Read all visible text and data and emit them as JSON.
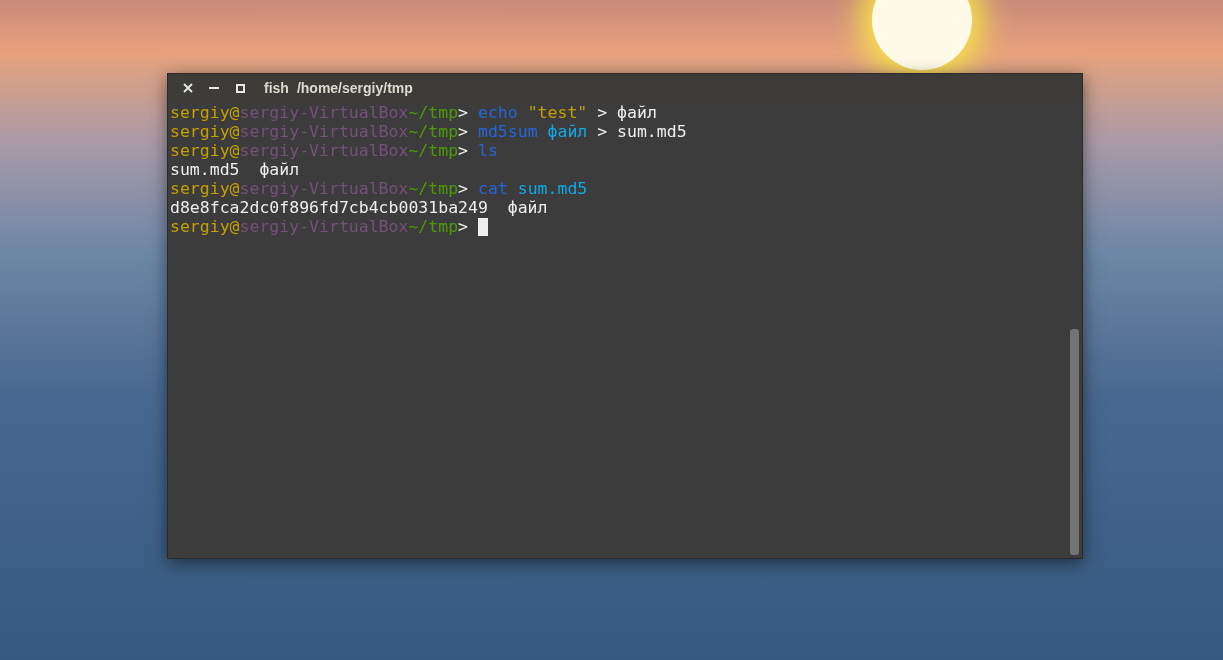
{
  "window": {
    "title_app": "fish",
    "title_path": "/home/sergiy/tmp"
  },
  "terminal": {
    "lines": [
      {
        "segments": [
          {
            "kind": "user",
            "text": "sergiy@"
          },
          {
            "kind": "host",
            "text": "sergiy-VirtualBox"
          },
          {
            "kind": "path",
            "text": "~/tmp"
          },
          {
            "kind": "plain",
            "text": "> "
          },
          {
            "kind": "command",
            "text": "echo"
          },
          {
            "kind": "string",
            "text": " \"test\""
          },
          {
            "kind": "plain",
            "text": " > файл"
          }
        ]
      },
      {
        "segments": [
          {
            "kind": "user",
            "text": "sergiy@"
          },
          {
            "kind": "host",
            "text": "sergiy-VirtualBox"
          },
          {
            "kind": "path",
            "text": "~/tmp"
          },
          {
            "kind": "plain",
            "text": "> "
          },
          {
            "kind": "command",
            "text": "md5sum"
          },
          {
            "kind": "argument",
            "text": " файл"
          },
          {
            "kind": "plain",
            "text": " > sum.md5"
          }
        ]
      },
      {
        "segments": [
          {
            "kind": "user",
            "text": "sergiy@"
          },
          {
            "kind": "host",
            "text": "sergiy-VirtualBox"
          },
          {
            "kind": "path",
            "text": "~/tmp"
          },
          {
            "kind": "plain",
            "text": "> "
          },
          {
            "kind": "command",
            "text": "ls"
          }
        ]
      },
      {
        "segments": [
          {
            "kind": "plain",
            "text": "sum.md5  файл"
          }
        ]
      },
      {
        "segments": [
          {
            "kind": "user",
            "text": "sergiy@"
          },
          {
            "kind": "host",
            "text": "sergiy-VirtualBox"
          },
          {
            "kind": "path",
            "text": "~/tmp"
          },
          {
            "kind": "plain",
            "text": "> "
          },
          {
            "kind": "command",
            "text": "cat"
          },
          {
            "kind": "argument",
            "text": " sum.md5"
          }
        ]
      },
      {
        "segments": [
          {
            "kind": "plain",
            "text": "d8e8fca2dc0f896fd7cb4cb0031ba249  файл"
          }
        ]
      },
      {
        "segments": [
          {
            "kind": "user",
            "text": "sergiy@"
          },
          {
            "kind": "host",
            "text": "sergiy-VirtualBox"
          },
          {
            "kind": "path",
            "text": "~/tmp"
          },
          {
            "kind": "plain",
            "text": "> "
          }
        ],
        "cursor": true
      }
    ]
  }
}
